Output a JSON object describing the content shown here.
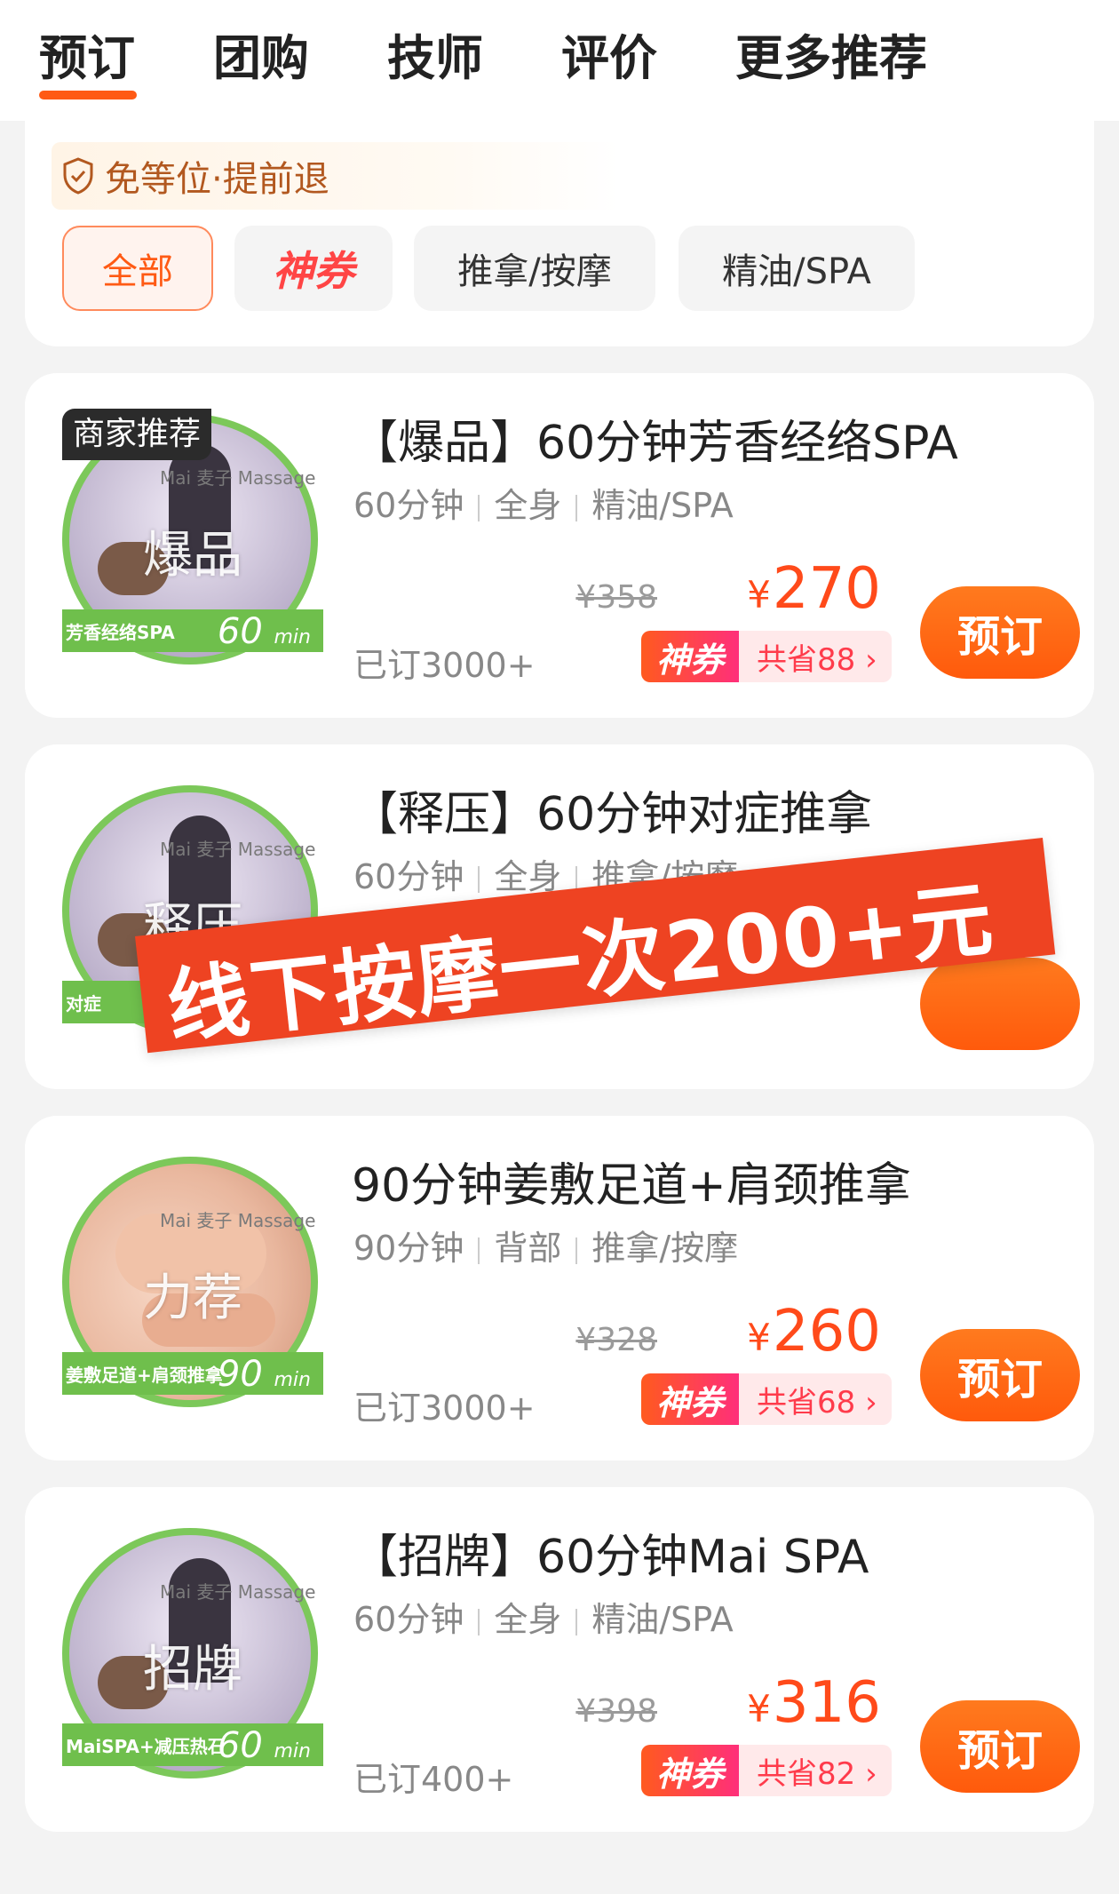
{
  "tabs": [
    "预订",
    "团购",
    "技师",
    "评价",
    "更多推荐"
  ],
  "active_tab": "预订",
  "guarantee_text": "免等位·提前退",
  "filters": [
    "全部",
    "神券",
    "推拿/按摩",
    "精油/SPA"
  ],
  "active_filter": "全部",
  "colors": {
    "accent": "#ff5a14",
    "price": "#ff4a1a",
    "stamp": "#ee4322",
    "green": "#6fbf4c"
  },
  "products": [
    {
      "merchant_tag": "商家推荐",
      "thumb_overlay": "爆品",
      "thumb_brand": "Mai 麦子 Massage",
      "thumb_label": "芳香经络SPA",
      "thumb_minutes": "60",
      "thumb_unit": "min",
      "title": "【爆品】60分钟芳香经络SPA",
      "duration": "60分钟",
      "area": "全身",
      "category": "精油/SPA",
      "old_price": "¥358",
      "price_symbol": "¥",
      "price": "270",
      "coupon_label": "神券",
      "saving": "共省88 ›",
      "sold": "已订3000+",
      "button": "预订"
    },
    {
      "thumb_overlay": "释压",
      "thumb_brand": "Mai 麦子 Massage",
      "thumb_label": "对症",
      "title": "【释压】60分钟对症推拿",
      "duration": "60分钟",
      "area": "全身",
      "category": "推拿/按摩"
    },
    {
      "thumb_overlay": "力荐",
      "thumb_brand": "Mai 麦子 Massage",
      "thumb_label": "姜敷足道+肩颈推拿",
      "thumb_minutes": "90",
      "thumb_unit": "min",
      "title": "90分钟姜敷足道+肩颈推拿",
      "duration": "90分钟",
      "area": "背部",
      "category": "推拿/按摩",
      "old_price": "¥328",
      "price_symbol": "¥",
      "price": "260",
      "coupon_label": "神券",
      "saving": "共省68 ›",
      "sold": "已订3000+",
      "button": "预订"
    },
    {
      "thumb_overlay": "招牌",
      "thumb_brand": "Mai 麦子 Massage",
      "thumb_label": "MaiSPA+减压热石",
      "thumb_minutes": "60",
      "thumb_unit": "min",
      "title": "【招牌】60分钟Mai SPA",
      "duration": "60分钟",
      "area": "全身",
      "category": "精油/SPA",
      "old_price": "¥398",
      "price_symbol": "¥",
      "price": "316",
      "coupon_label": "神券",
      "saving": "共省82 ›",
      "sold": "已订400+",
      "button": "预订"
    }
  ],
  "overlay_stamp": "线下按摩一次200+元"
}
